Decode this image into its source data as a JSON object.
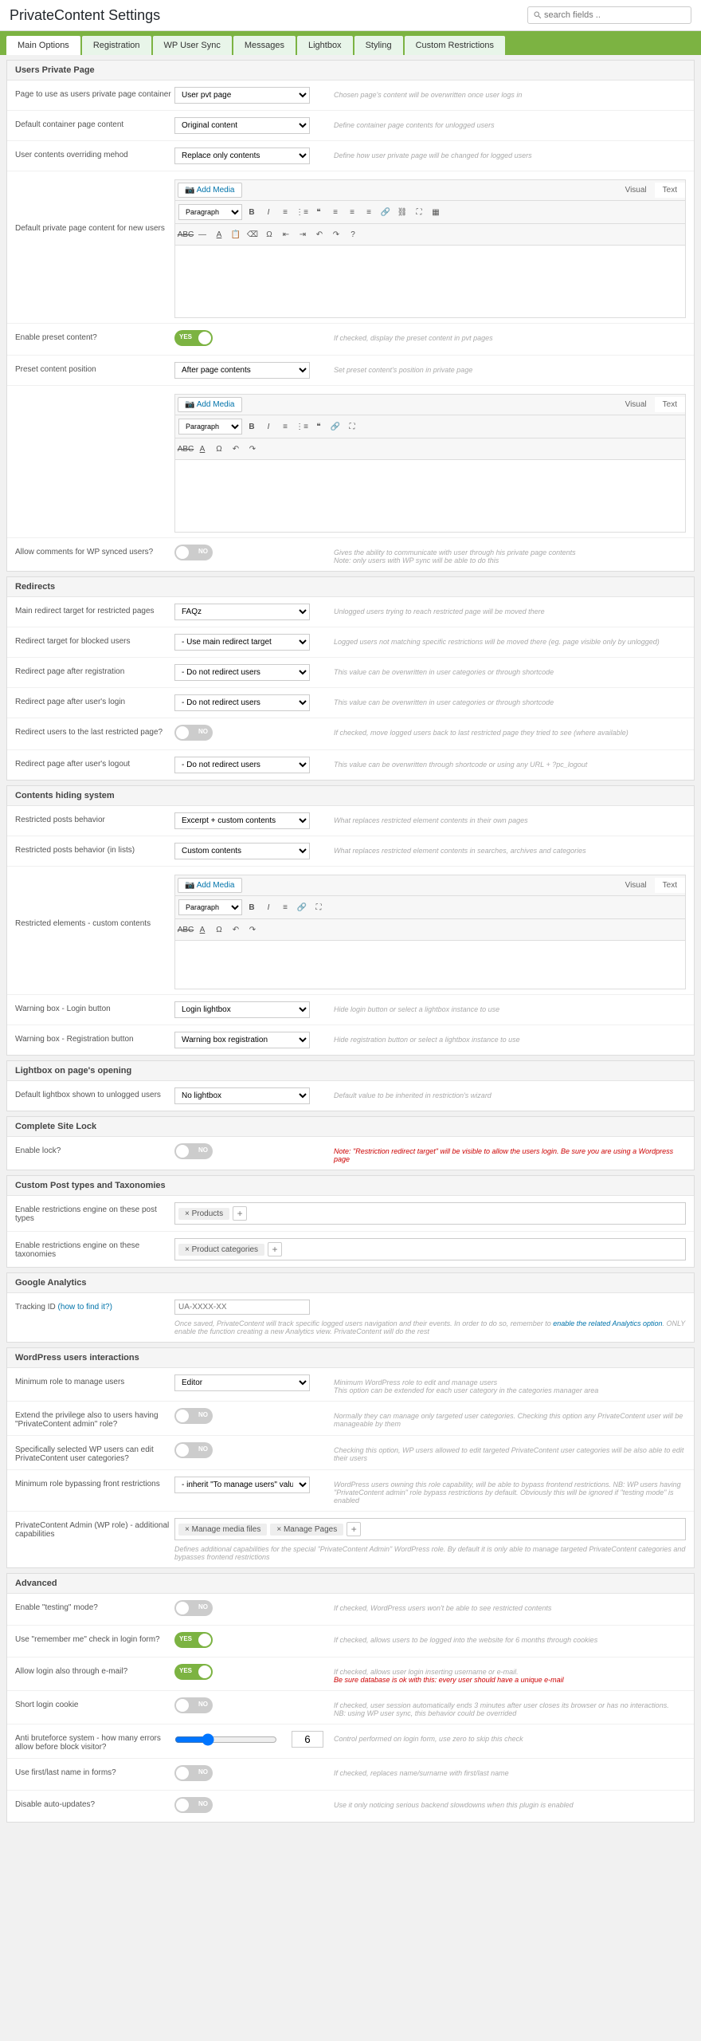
{
  "page_title": "PrivateContent Settings",
  "search_placeholder": "search fields ..",
  "tabs": [
    "Main Options",
    "Registration",
    "WP User Sync",
    "Messages",
    "Lightbox",
    "Styling",
    "Custom Restrictions"
  ],
  "sections": {
    "users_pvt": {
      "title": "Users Private Page",
      "pvt_page_label": "Page to use as users private page container",
      "pvt_page_value": "User pvt page",
      "pvt_page_help": "Chosen page's content will be overwritten once user logs in",
      "default_container_label": "Default container page content",
      "default_container_value": "Original content",
      "default_container_help": "Define container page contents for unlogged users",
      "override_method_label": "User contents overriding mehod",
      "override_method_value": "Replace only contents",
      "override_method_help": "Define how user private page will be changed for logged users",
      "default_new_label": "Default private page content for new users",
      "preset_label": "Enable preset content?",
      "preset_help": "If checked, display the preset content in pvt pages",
      "preset_pos_label": "Preset content position",
      "preset_pos_value": "After page contents",
      "preset_pos_help": "Set preset content's position in private page",
      "allow_comments_label": "Allow comments for WP synced users?",
      "allow_comments_help": "Gives the ability to communicate with user through his private page contents",
      "allow_comments_note": "Note: only users with WP sync will be able to do this"
    },
    "redirects": {
      "title": "Redirects",
      "main_target_label": "Main redirect target for restricted pages",
      "main_target_value": "FAQz",
      "main_target_help": "Unlogged users trying to reach restricted page will be moved there",
      "blocked_label": "Redirect target for blocked users",
      "blocked_value": "- Use main redirect target",
      "blocked_help": "Logged users not matching specific restrictions will be moved there (eg. page visible only by unlogged)",
      "after_reg_label": "Redirect page after registration",
      "after_reg_value": "- Do not redirect users",
      "after_reg_help": "This value can be overwritten in user categories or through shortcode",
      "after_login_label": "Redirect page after user's login",
      "after_login_value": "- Do not redirect users",
      "after_login_help": "This value can be overwritten in user categories or through shortcode",
      "last_restricted_label": "Redirect users to the last restricted page?",
      "last_restricted_help": "If checked, move logged users back to last restricted page they tried to see (where available)",
      "after_logout_label": "Redirect page after user's logout",
      "after_logout_value": "- Do not redirect users",
      "after_logout_help": "This value can be overwritten through shortcode or using any URL + ?pc_logout"
    },
    "hiding": {
      "title": "Contents hiding system",
      "posts_behavior_label": "Restricted posts behavior",
      "posts_behavior_value": "Excerpt + custom contents",
      "posts_behavior_help": "What replaces restricted element contents in their own pages",
      "lists_behavior_label": "Restricted posts behavior (in lists)",
      "lists_behavior_value": "Custom contents",
      "lists_behavior_help": "What replaces restricted element contents in searches, archives and categories",
      "custom_contents_label": "Restricted elements - custom contents",
      "warn_login_label": "Warning box - Login button",
      "warn_login_value": "Login lightbox",
      "warn_login_help": "Hide login button or select a lightbox instance to use",
      "warn_reg_label": "Warning box - Registration button",
      "warn_reg_value": "Warning box registration",
      "warn_reg_help": "Hide registration button or select a lightbox instance to use"
    },
    "lightbox_open": {
      "title": "Lightbox on page's opening",
      "default_label": "Default lightbox shown to unlogged users",
      "default_value": "No lightbox",
      "default_help": "Default value to be inherited in restriction's wizard"
    },
    "site_lock": {
      "title": "Complete Site Lock",
      "enable_label": "Enable lock?",
      "enable_help": "Note: \"Restriction redirect target\" will be visible to allow the users login. Be sure you are using a Wordpress page"
    },
    "cpt": {
      "title": "Custom Post types and Taxonomies",
      "pt_label": "Enable restrictions engine on these post types",
      "pt_tag": "Products",
      "tax_label": "Enable restrictions engine on these taxonomies",
      "tax_tag": "Product categories"
    },
    "ga": {
      "title": "Google Analytics",
      "tracking_label": "Tracking ID",
      "tracking_hint": "(how to find it?)",
      "tracking_placeholder": "UA-XXXX-XX",
      "tracking_help1": "Once saved, PrivateContent will track specific logged users navigation and their events. In order to do so, remember to ",
      "tracking_help_link": "enable the related Analytics option",
      "tracking_help2": ". ONLY enable the function creating a new Analytics view. PrivateContent will do the rest"
    },
    "wp_users": {
      "title": "WordPress users interactions",
      "min_role_label": "Minimum role to manage users",
      "min_role_value": "Editor",
      "min_role_help1": "Minimum WordPress role to edit and manage users",
      "min_role_help2": "This option can be extended for each user category in the categories manager area",
      "extend_priv_label": "Extend the privilege also to users having \"PrivateContent admin\" role?",
      "extend_priv_help": "Normally they can manage only targeted user categories. Checking this option any PrivateContent user will be manageable by them",
      "specific_label": "Specifically selected WP users can edit PrivateContent user categories?",
      "specific_help": "Checking this option, WP users allowed to edit targeted PrivateContent user categories will be also able to edit their users",
      "bypass_label": "Minimum role bypassing front restrictions",
      "bypass_value": "- inherit \"To manage users\" value",
      "bypass_help": "WordPress users owning this role capability, will be able to bypass frontend restrictions. NB: WP users having \"PrivateContent admin\" role bypass restrictions by default. Obviously this will be ignored if \"testing mode\" is enabled",
      "admin_cap_label": "PrivateContent Admin (WP role) - additional capabilities",
      "admin_cap_tag1": "Manage media files",
      "admin_cap_tag2": "Manage Pages",
      "admin_cap_help": "Defines additional capabilities for the special \"PrivateContent Admin\" WordPress role. By default it is only able to manage targeted PrivateContent categories and bypasses frontend restrictions"
    },
    "advanced": {
      "title": "Advanced",
      "testing_label": "Enable \"testing\" mode?",
      "testing_help": "If checked, WordPress users won't be able to see restricted contents",
      "remember_label": "Use \"remember me\" check in login form?",
      "remember_help": "If checked, allows users to be logged into the website for 6 months through cookies",
      "email_login_label": "Allow login also through e-mail?",
      "email_login_help1": "If checked, allows user login inserting username or e-mail.",
      "email_login_help2": "Be sure database is ok with this: every user should have a unique e-mail",
      "short_cookie_label": "Short login cookie",
      "short_cookie_help1": "If checked, user session automatically ends 3 minutes after user closes its browser or has no interactions.",
      "short_cookie_help2": "NB: using WP user sync, this behavior could be overrided",
      "brute_label": "Anti bruteforce system - how many errors allow before block visitor?",
      "brute_value": "6",
      "brute_help": "Control performed on login form, use zero to skip this check",
      "flname_label": "Use first/last name in forms?",
      "flname_help": "If checked, replaces name/surname with first/last name",
      "autoupdate_label": "Disable auto-updates?",
      "autoupdate_help": "Use it only noticing serious backend slowdowns when this plugin is enabled"
    }
  },
  "editor": {
    "add_media": "Add Media",
    "visual": "Visual",
    "text": "Text",
    "paragraph": "Paragraph"
  },
  "toggle": {
    "yes": "YES",
    "no": "NO"
  }
}
